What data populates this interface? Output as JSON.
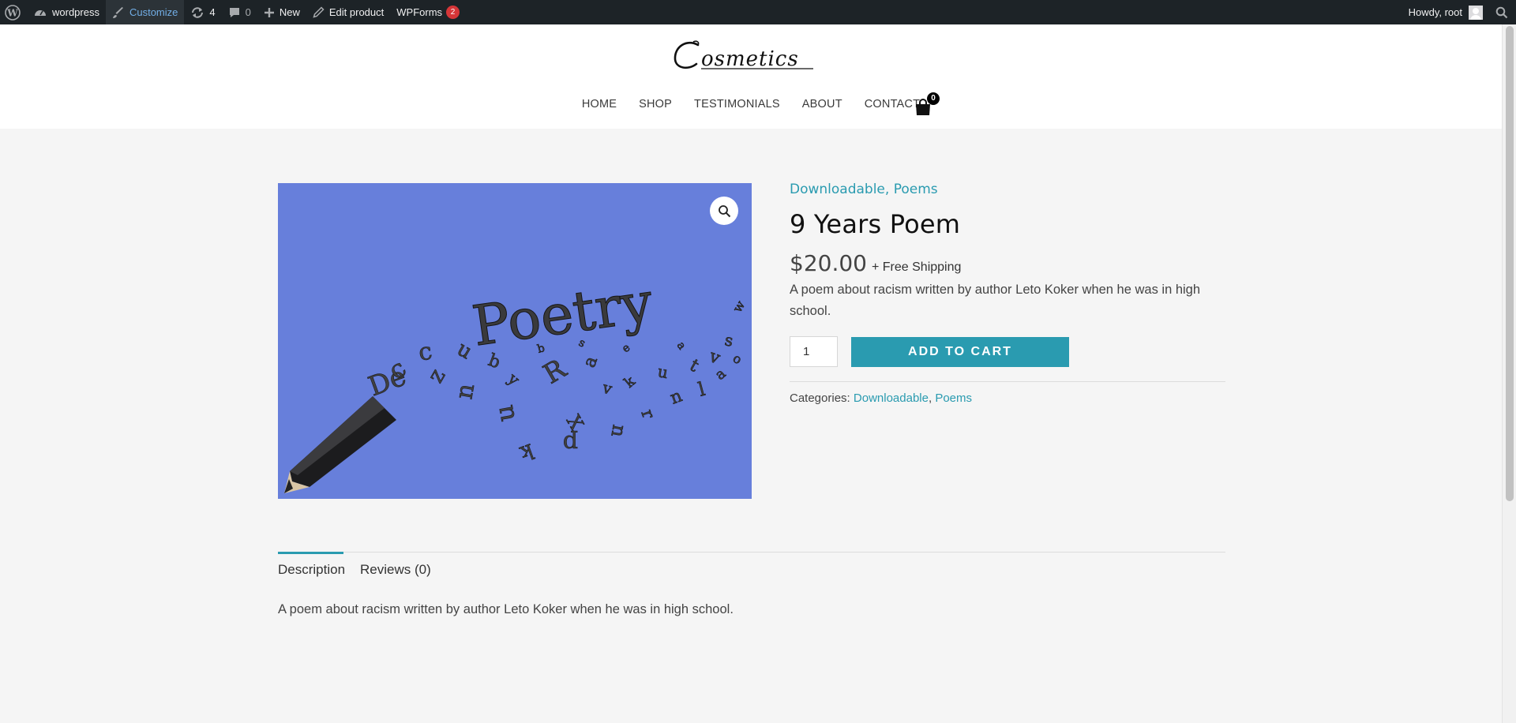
{
  "admin_bar": {
    "site_name": "wordpress",
    "customize": "Customize",
    "updates_count": "4",
    "comments_count": "0",
    "new_label": "New",
    "edit_product": "Edit product",
    "wpforms": "WPForms",
    "wpforms_badge": "2",
    "howdy": "Howdy, root"
  },
  "header": {
    "logo_text": "Cosmetics",
    "nav": [
      "HOME",
      "SHOP",
      "TESTIMONIALS",
      "ABOUT",
      "CONTACT"
    ],
    "cart_count": "0"
  },
  "product": {
    "image_text": "Poetry",
    "categories_top": [
      "Downloadable",
      "Poems"
    ],
    "title": "9 Years Poem",
    "price": "$20.00",
    "shipping": "+ Free Shipping",
    "short_description": "A poem about racism written by author Leto Koker when he was in high school.",
    "quantity": "1",
    "add_to_cart": "ADD TO CART",
    "categories_label": "Categories:",
    "categories": [
      "Downloadable",
      "Poems"
    ]
  },
  "tabs": {
    "description": "Description",
    "reviews": "Reviews (0)",
    "description_text": "A poem about racism written by author Leto Koker when he was in high school."
  },
  "colors": {
    "accent": "#2a9bb0",
    "admin_bar": "#1d2327",
    "image_bg": "#677fdb",
    "badge": "#d63638"
  }
}
